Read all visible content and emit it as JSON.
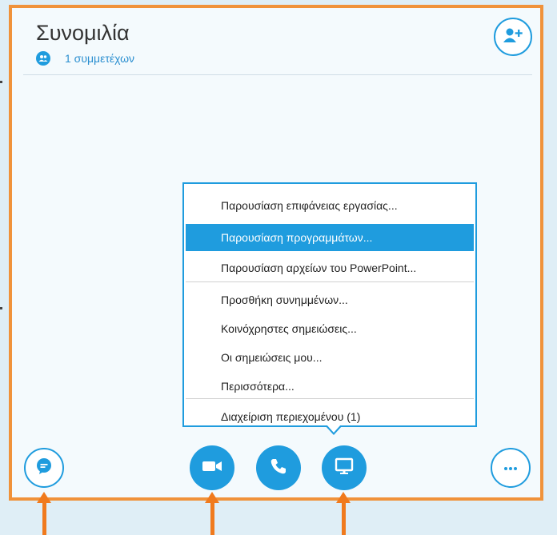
{
  "conversation": {
    "title": "Συνομιλία",
    "participants_label": "1 συμμετέχων"
  },
  "menu": {
    "items": [
      {
        "label": "Παρουσίαση επιφάνειας εργασίας...",
        "selected": false
      },
      {
        "label": "Παρουσίαση προγραμμάτων...",
        "selected": true
      },
      {
        "label": "Παρουσίαση αρχείων του PowerPoint...",
        "selected": false
      },
      {
        "label": "Προσθήκη συνημμένων...",
        "selected": false
      },
      {
        "label": "Κοινόχρηστες σημειώσεις...",
        "selected": false
      },
      {
        "label": "Οι σημειώσεις μου...",
        "selected": false
      },
      {
        "label": "Περισσότερα...",
        "selected": false
      },
      {
        "label": "Διαχείριση περιεχομένου (1)",
        "selected": false
      }
    ]
  },
  "icons": {
    "participants": "people-icon",
    "add_person": "add-person-icon",
    "chat": "chat-icon",
    "video": "video-camera-icon",
    "call": "phone-icon",
    "share": "monitor-icon",
    "more": "more-icon"
  },
  "colors": {
    "accent": "#1f9cde",
    "highlight_border": "#f0923a",
    "arrow": "#f07a1d",
    "selected_item_text": "#ffffff"
  }
}
